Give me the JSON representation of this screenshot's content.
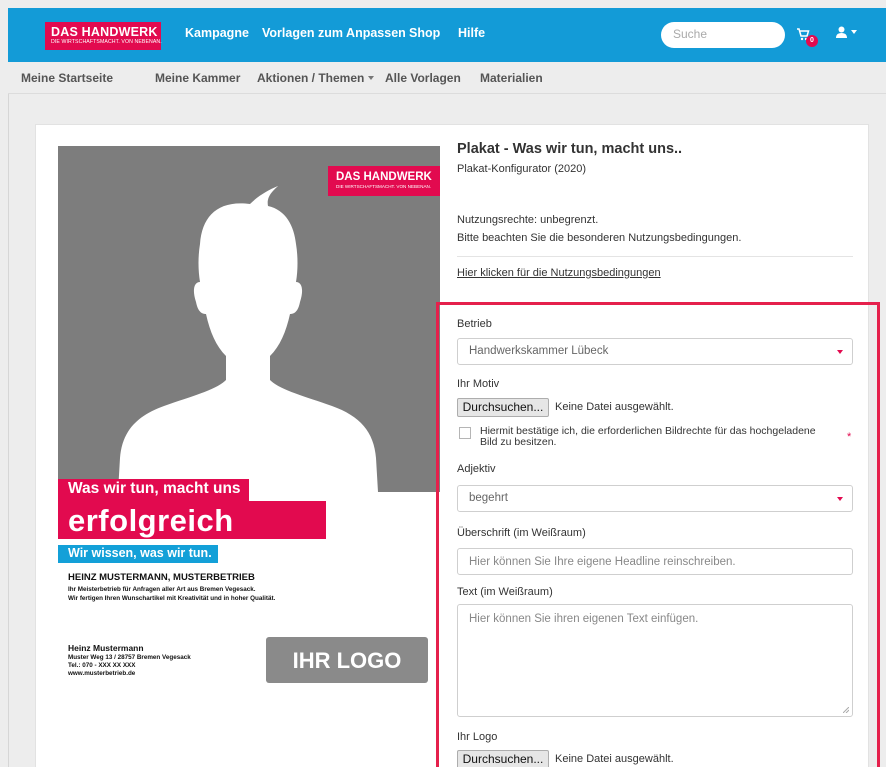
{
  "brand": {
    "name": "DAS HANDWERK",
    "tagline": "DIE WIRTSCHAFTSMACHT. VON NEBENAN.",
    "color": "#e20a4f"
  },
  "topnav": {
    "links": [
      "Kampagne",
      "Vorlagen zum Anpassen",
      "Shop",
      "Hilfe"
    ],
    "search_placeholder": "Suche",
    "cart_count": "0",
    "cart_icon": "cart-icon",
    "user_icon": "user-icon",
    "color": "#139bd7"
  },
  "subnav": {
    "links": [
      "Meine Startseite",
      "Meine Kammer",
      "Aktionen / Themen",
      "Alle Vorlagen",
      "Materialien"
    ]
  },
  "poster": {
    "headline1": "Was wir tun, macht uns",
    "headline2": "erfolgreich",
    "headline3": "Wir wissen, was wir tun.",
    "company": "HEINZ MUSTERMANN, MUSTERBETRIEB",
    "desc1": "Ihr Meisterbetrieb für Anfragen aller Art aus Bremen Vegesack.",
    "desc2": "Wir fertigen Ihren Wunschartikel mit Kreativität und in hoher Qualität.",
    "contact_name": "Heinz Mustermann",
    "contact_address": "Muster Weg 13 / 28757 Bremen Vegesack",
    "contact_phone": "Tel.: 070 - XXX XX XXX",
    "contact_web": "www.musterbetrieb.de",
    "logo_placeholder": "IHR LOGO"
  },
  "product": {
    "title": "Plakat - Was wir tun, macht uns..",
    "subtitle": "Plakat-Konfigurator (2020)",
    "rights": "Nutzungsrechte: unbegrenzt.",
    "rights_note": "Bitte beachten Sie die besonderen Nutzungsbedingungen.",
    "terms_link": "Hier klicken für die Nutzungsbedingungen"
  },
  "form": {
    "betrieb_label": "Betrieb",
    "betrieb_value": "Handwerkskammer Lübeck",
    "motiv_label": "Ihr Motiv",
    "browse_label": "Durchsuchen...",
    "no_file": "Keine Datei ausgewählt.",
    "rights_confirm": "Hiermit bestätige ich, die erforderlichen Bildrechte für das hochgeladene Bild zu besitzen.",
    "required_mark": "*",
    "adjektiv_label": "Adjektiv",
    "adjektiv_value": "begehrt",
    "headline_label": "Überschrift (im Weißraum)",
    "headline_placeholder": "Hier können Sie Ihre eigene Headline reinschreiben.",
    "text_label": "Text (im Weißraum)",
    "text_placeholder": "Hier können Sie ihren eigenen Text einfügen.",
    "logo_label": "Ihr Logo",
    "logo_browse_label": "Durchsuchen...",
    "logo_no_file": "Keine Datei ausgewählt.",
    "highlight_color": "#e5204c"
  }
}
